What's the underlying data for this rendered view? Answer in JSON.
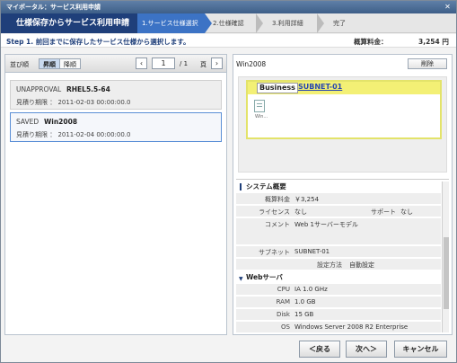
{
  "window": {
    "title": "マイポータル：サービス利用申請",
    "close": "✕"
  },
  "wizard": {
    "title": "仕様保存からサービス利用申請",
    "steps": [
      {
        "label": "1.サービス仕様選択"
      },
      {
        "label": "2.仕様確認"
      },
      {
        "label": "3.利用詳細"
      },
      {
        "label": "完了"
      }
    ]
  },
  "instruction": "Step 1. 前回までに保存したサービス仕様から選択します。",
  "fee": {
    "label": "概算料金：",
    "value": "3,254 円"
  },
  "list": {
    "sort_label": "並び順",
    "sort_asc": "昇順",
    "sort_desc": "降順",
    "prev_icon": "‹",
    "page_value": "1",
    "page_total": "/ 1",
    "page_unit": "頁",
    "next_icon": "›",
    "items": [
      {
        "status": "UNAPPROVAL",
        "name": "RHEL5.5-64",
        "date": "見積り期限 ： 2011-02-03 00:00:00.0"
      },
      {
        "status": "SAVED",
        "name": "Win2008",
        "date": "見積り期限 ： 2011-02-04 00:00:00.0"
      }
    ]
  },
  "detail": {
    "title": "Win2008",
    "delete_label": "削除",
    "diagram": {
      "business_tag": "Business",
      "subnet": "SUBNET-01",
      "server_label": "Win..."
    },
    "system_section": "システム概要",
    "system_rows": [
      {
        "k": "概算料金",
        "v": "￥3,254"
      },
      {
        "k": "ライセンス",
        "v": "なし"
      },
      {
        "k": "コメント",
        "v": "Web 1サーバーモデル"
      },
      {
        "k": "サブネット",
        "v": "SUBNET-01"
      },
      {
        "k": "",
        "v": ""
      }
    ],
    "support_label": "サポート",
    "support_value": "なし",
    "setting_label": "設定方法",
    "setting_value": "自動設定",
    "web_section": "Webサーバ",
    "web_rows": [
      {
        "k": "CPU",
        "v": "IA 1.0 GHz"
      },
      {
        "k": "RAM",
        "v": "1.0 GB"
      },
      {
        "k": "Disk",
        "v": "15 GB"
      },
      {
        "k": "OS",
        "v": "Windows Server 2008 R2 Enterprise"
      }
    ]
  },
  "footer": {
    "back": "＜戻る",
    "next": "次へ＞",
    "cancel": "キャンセル"
  }
}
